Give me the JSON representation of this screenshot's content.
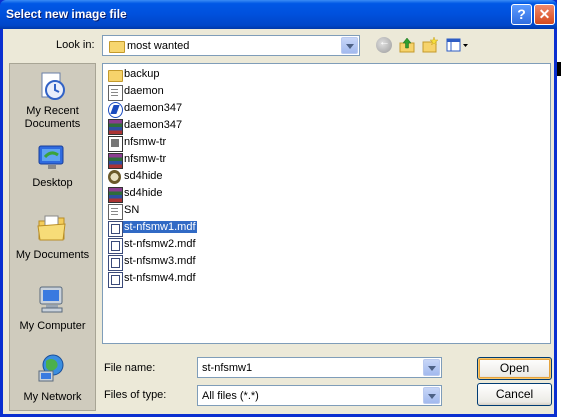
{
  "window": {
    "title": "Select new image file",
    "help_label": "?",
    "close_label": "✕"
  },
  "lookin": {
    "label": "Look in:",
    "value": "most wanted"
  },
  "toolbar": {
    "icons": [
      "back-icon",
      "up-folder-icon",
      "new-folder-icon",
      "views-menu-icon"
    ]
  },
  "places": [
    {
      "label": "My Recent Documents",
      "icon": "recent-documents-icon"
    },
    {
      "label": "Desktop",
      "icon": "desktop-icon"
    },
    {
      "label": "My Documents",
      "icon": "my-documents-icon"
    },
    {
      "label": "My Computer",
      "icon": "my-computer-icon"
    },
    {
      "label": "My Network",
      "icon": "my-network-icon"
    }
  ],
  "files": [
    {
      "name": "backup",
      "icon": "folder-icon",
      "selected": false
    },
    {
      "name": "daemon",
      "icon": "text-document-icon",
      "selected": false
    },
    {
      "name": "daemon347",
      "icon": "executable-icon",
      "selected": false
    },
    {
      "name": "daemon347",
      "icon": "rar-archive-icon",
      "selected": false
    },
    {
      "name": "nfsmw-tr",
      "icon": "batch-file-icon",
      "selected": false
    },
    {
      "name": "nfsmw-tr",
      "icon": "rar-archive-icon",
      "selected": false
    },
    {
      "name": "sd4hide",
      "icon": "skull-executable-icon",
      "selected": false
    },
    {
      "name": "sd4hide",
      "icon": "rar-archive-icon",
      "selected": false
    },
    {
      "name": "SN",
      "icon": "text-document-icon",
      "selected": false
    },
    {
      "name": "st-nfsmw1.mdf",
      "icon": "mdf-image-icon",
      "selected": true
    },
    {
      "name": "st-nfsmw2.mdf",
      "icon": "mdf-image-icon",
      "selected": false
    },
    {
      "name": "st-nfsmw3.mdf",
      "icon": "mdf-image-icon",
      "selected": false
    },
    {
      "name": "st-nfsmw4.mdf",
      "icon": "mdf-image-icon",
      "selected": false
    }
  ],
  "filename": {
    "label": "File name:",
    "value": "st-nfsmw1"
  },
  "filetype": {
    "label": "Files of type:",
    "value": "All files (*.*)"
  },
  "buttons": {
    "open": "Open",
    "cancel": "Cancel"
  }
}
